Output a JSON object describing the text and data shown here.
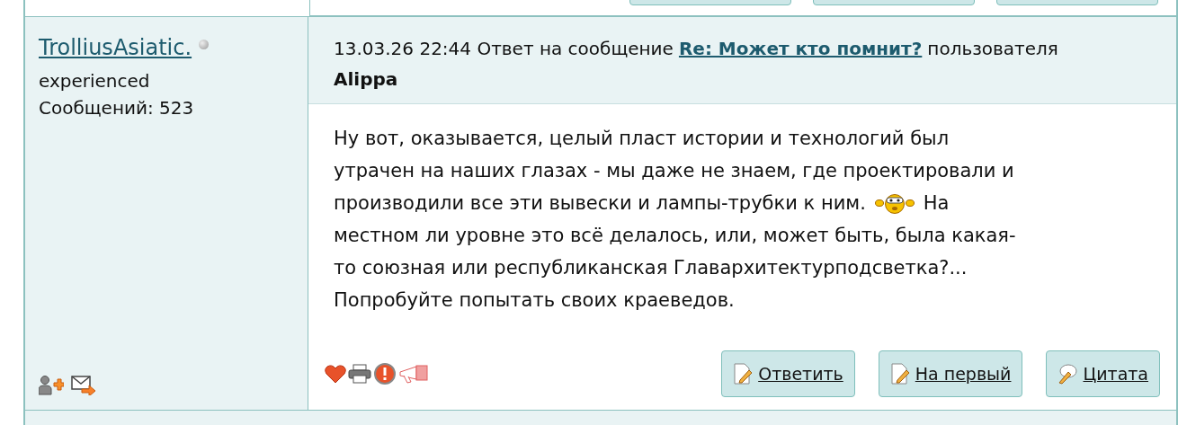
{
  "author": {
    "name": "TrolliusAsiatic.",
    "online": false,
    "rank": "experienced",
    "posts": "Сообщений: 523"
  },
  "post": {
    "meta": "13.03.26 22:44 Ответ на сообщение",
    "reply_link": "Re: Может кто помнит?",
    "meta_tail": "пользователя",
    "reply_author": "Alippa",
    "lines": [
      {
        "kind": "text",
        "text": "Ну вот, оказывается, целый пласт истории и технологий был"
      },
      {
        "kind": "text",
        "text": "утрачен на наших глазах - мы даже не знаем, где проектировали и"
      },
      {
        "kind": "emoticon",
        "before": "производили все эти вывески и лампы-трубки к ним.",
        "after": "На"
      },
      {
        "kind": "text",
        "text": "местном ли уровне это всё делалось, или, может быть, была какая-"
      },
      {
        "kind": "text",
        "text": "то союзная или республиканская Главархитектурподсветка?..."
      },
      {
        "kind": "text",
        "text": "Попробуйте попытать своих краеведов."
      }
    ]
  },
  "buttons": [
    {
      "label": "Ответить",
      "kind": "reply"
    },
    {
      "label": "На первый",
      "kind": "reply"
    },
    {
      "label": "Цитата",
      "kind": "quote"
    }
  ]
}
